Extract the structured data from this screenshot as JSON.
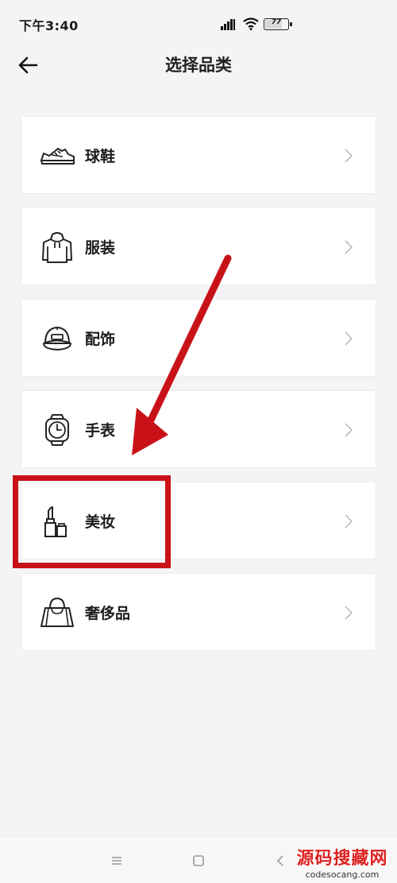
{
  "status_bar": {
    "time": "下午3:40",
    "battery": "77",
    "battery_fraction": 0.77
  },
  "header": {
    "back_icon": "arrow-left-icon",
    "title": "选择品类"
  },
  "categories": [
    {
      "label": "球鞋",
      "icon": "sneaker-icon"
    },
    {
      "label": "服装",
      "icon": "hoodie-icon"
    },
    {
      "label": "配饰",
      "icon": "cap-icon"
    },
    {
      "label": "手表",
      "icon": "watch-icon"
    },
    {
      "label": "美妆",
      "icon": "lipstick-icon"
    },
    {
      "label": "奢侈品",
      "icon": "handbag-icon"
    }
  ],
  "annotation": {
    "highlighted_item": "美妆",
    "color": "#c81218"
  },
  "nav_bar": {
    "buttons": [
      "menu-icon",
      "home-icon",
      "back-icon"
    ]
  },
  "watermark": {
    "main": "源码搜藏网",
    "sub": "codesocang.com"
  }
}
